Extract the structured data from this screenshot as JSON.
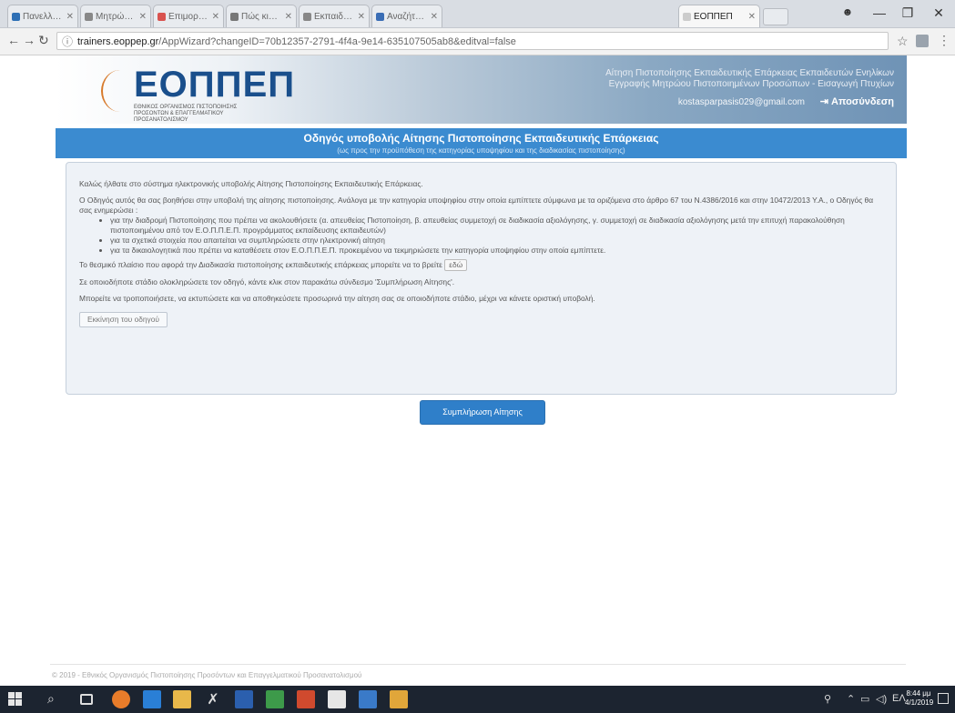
{
  "browser": {
    "tabs": [
      {
        "label": "Πανελλήνιο Μητ…",
        "color": "#2d6fb5"
      },
      {
        "label": "Μητρώο Αξιολ…",
        "color": "#888888"
      },
      {
        "label": "Επιμορφωσ…",
        "color": "#d9534f"
      },
      {
        "label": "Πώς κινητοπ…",
        "color": "#777777"
      },
      {
        "label": "Εκπαιδευτικοί…",
        "color": "#888888"
      },
      {
        "label": "Αναζήτηση Δι…",
        "color": "#3a6db5"
      },
      {
        "label": "ΕΟΠΠΕΠ",
        "color": "#cccccc",
        "active": true
      }
    ],
    "url_host": "trainers.eoppep.gr",
    "url_path": "/AppWizard?changeID=70b12357-2791-4f4a-9e14-635107505ab8&editval=false",
    "window_controls": [
      "—",
      "❐",
      "✕"
    ]
  },
  "header": {
    "logo_text": "ΕΟΠΠΕΠ",
    "logo_sub": "ΕΘΝΙΚΟΣ ΟΡΓΑΝΙΣΜΟΣ ΠΙΣΤΟΠΟΙΗΣΗΣ ΠΡΟΣΟΝΤΩΝ & ΕΠΑΓΓΕΛΜΑΤΙΚΟΥ ΠΡΟΣΑΝΑΤΟΛΙΣΜΟΥ",
    "right_line1": "Αίτηση Πιστοποίησης Εκπαιδευτικής Επάρκειας Εκπαιδευτών Ενηλίκων",
    "right_line2": "Εγγραφής Μητρώου Πιστοποιημένων Προσώπων - Εισαγωγή Πτυχίων",
    "user_email": "kostasparpasis029@gmail.com",
    "logout_label": "Αποσύνδεση"
  },
  "titlebar": {
    "title": "Οδηγός υποβολής Αίτησης Πιστοποίησης Εκπαιδευτικής Επάρκειας",
    "subtitle": "(ως προς την προϋπόθεση της κατηγορίας υποψηφίου και της διαδικασίας πιστοποίησης)"
  },
  "guide": {
    "p1": "Καλώς ήλθατε στο σύστημα ηλεκτρονικής υποβολής Αίτησης Πιστοποίησης Εκπαιδευτικής Επάρκειας.",
    "p2": "Ο Οδηγός αυτός θα σας βοηθήσει στην υποβολή της αίτησης πιστοποίησης. Ανάλογα με την κατηγορία υποψηφίου στην οποία εμπίπτετε σύμφωνα με τα οριζόμενα στο άρθρο 67 του Ν.4386/2016 και στην 10472/2013 Υ.Α., ο Οδηγός θα σας ενημερώσει :",
    "bullets": [
      "για την διαδρομή Πιστοποίησης που πρέπει να ακολουθήσετε (α. απευθείας Πιστοποίηση, β. απευθείας συμμετοχή σε διαδικασία αξιολόγησης, γ. συμμετοχή σε διαδικασία αξιολόγησης μετά την επιτυχή παρακολούθηση πιστοποιημένου από τον Ε.Ο.Π.Π.Ε.Π. προγράμματος εκπαίδευσης εκπαιδευτών)",
      "για τα σχετικά στοιχεία που απαιτείται να συμπληρώσετε στην ηλεκτρονική αίτηση",
      "για τα δικαιολογητικά που πρέπει να καταθέσετε στον Ε.Ο.Π.Π.Ε.Π. προκειμένου να τεκμηριώσετε την κατηγορία υποψηφίου στην οποία εμπίπτετε."
    ],
    "p3": "Το θεσμικό πλαίσιο που αφορά την Διαδικασία πιστοποίησης εκπαιδευτικής επάρκειας μπορείτε να το βρείτε",
    "here_label": "εδώ",
    "p4": "Σε οποιοδήποτε στάδιο ολοκληρώσετε τον οδηγό, κάντε κλικ στον παρακάτω σύνδεσμο 'Συμπλήρωση Αίτησης'.",
    "p5": "Μπορείτε να τροποποιήσετε, να εκτυπώσετε και να αποθηκεύσετε προσωρινά την αίτηση σας σε οποιοδήποτε στάδιο, μέχρι να κάνετε οριστική υποβολή.",
    "back_label": "Εκκίνηση του οδηγού"
  },
  "complete_button": "Συμπλήρωση Αίτησης",
  "footer": "© 2019 - Εθνικός Οργανισμός Πιστοποίησης Προσόντων και Επαγγελματικού Προσανατολισμού",
  "taskbar": {
    "clock_time": "8:44 μμ",
    "clock_date": "4/1/2019"
  }
}
